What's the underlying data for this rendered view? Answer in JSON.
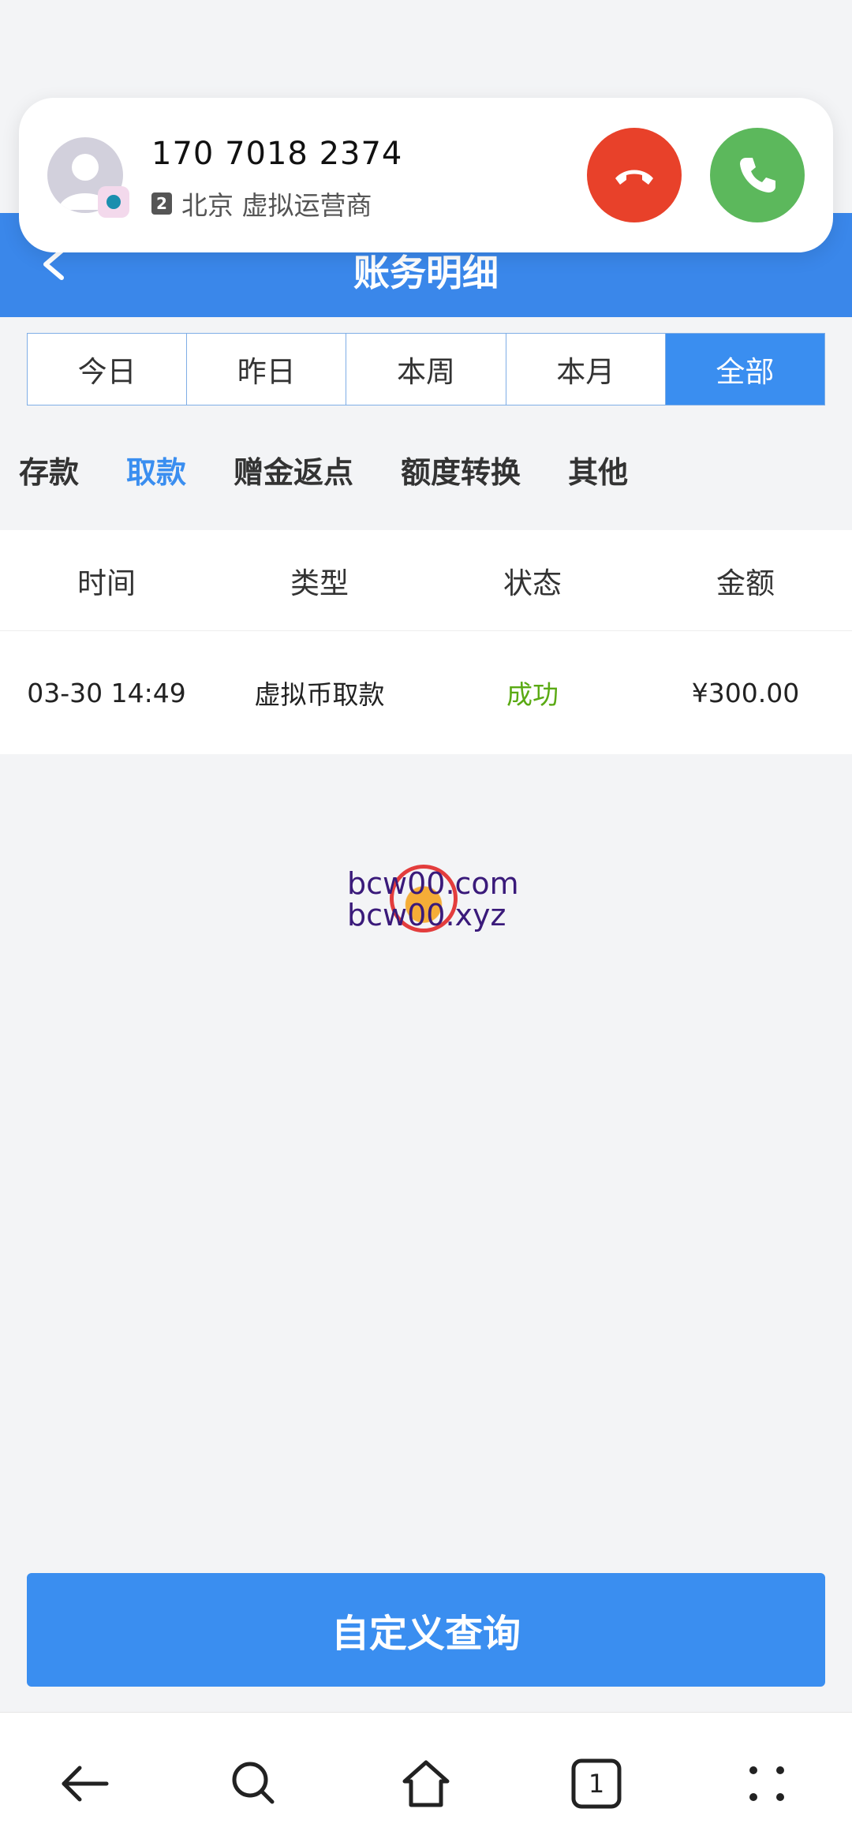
{
  "call": {
    "number": "170 7018 2374",
    "sim": "2",
    "location": "北京 虚拟运营商"
  },
  "header": {
    "title": "账务明细"
  },
  "period_tabs": [
    {
      "label": "今日"
    },
    {
      "label": "昨日"
    },
    {
      "label": "本周"
    },
    {
      "label": "本月"
    },
    {
      "label": "全部",
      "active": true
    }
  ],
  "type_tabs": [
    {
      "label": "存款"
    },
    {
      "label": "取款",
      "active": true
    },
    {
      "label": "赠金返点"
    },
    {
      "label": "额度转换"
    },
    {
      "label": "其他"
    }
  ],
  "table": {
    "columns": [
      "时间",
      "类型",
      "状态",
      "金额"
    ],
    "rows": [
      {
        "time": "03-30 14:49",
        "type": "虚拟币取款",
        "status": "成功",
        "amount": "¥300.00"
      }
    ]
  },
  "watermark": {
    "line1": "bcw00.com",
    "line2": "bcw00.xyz"
  },
  "query_button": {
    "label": "自定义查询"
  },
  "navbar": {
    "tab_count": "1"
  },
  "colors": {
    "primary": "#3a8ef0",
    "decline": "#e8412a",
    "accept": "#5cb85c",
    "success": "#5aaa14"
  }
}
